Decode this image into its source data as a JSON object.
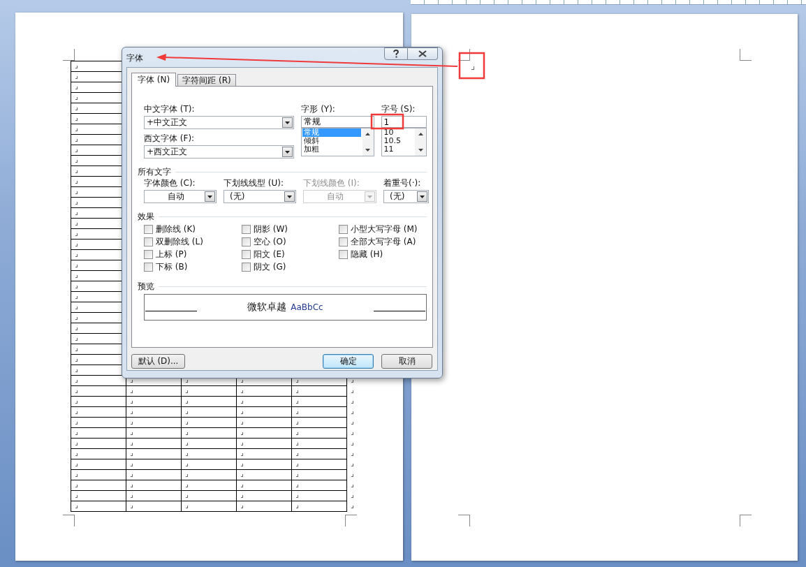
{
  "dialog": {
    "title": "字体",
    "tabs": [
      {
        "label": "字体 (N)",
        "selected": true
      },
      {
        "label": "字符间距 (R)",
        "selected": false
      }
    ],
    "chinese_font": {
      "label": "中文字体 (T):",
      "value": "+中文正文"
    },
    "western_font": {
      "label": "西文字体 (F):",
      "value": "+西文正文"
    },
    "font_style": {
      "label": "字形 (Y):",
      "value": "常规",
      "options": [
        {
          "label": "常规",
          "selected": true
        },
        {
          "label": "倾斜",
          "selected": false
        },
        {
          "label": "加粗",
          "selected": false
        }
      ]
    },
    "font_size": {
      "label": "字号 (S):",
      "value": "1",
      "options": [
        {
          "label": "10",
          "selected": false
        },
        {
          "label": "10.5",
          "selected": false
        },
        {
          "label": "11",
          "selected": false
        }
      ]
    },
    "all_text": {
      "heading": "所有文字",
      "fields": [
        {
          "label": "字体颜色 (C):",
          "value": "自动",
          "kind": "color",
          "disabled": false
        },
        {
          "label": "下划线线型 (U):",
          "value": "(无)",
          "kind": "style",
          "disabled": false
        },
        {
          "label": "下划线颜色 (I):",
          "value": "自动",
          "kind": "color",
          "disabled": true
        },
        {
          "label": "着重号(·):",
          "value": "(无)",
          "kind": "style",
          "disabled": false
        }
      ]
    },
    "effects": {
      "heading": "效果",
      "options": [
        {
          "label": "删除线 (K)",
          "checked": false
        },
        {
          "label": "双删除线 (L)",
          "checked": false
        },
        {
          "label": "上标 (P)",
          "checked": false
        },
        {
          "label": "下标 (B)",
          "checked": false
        },
        {
          "label": "阴影 (W)",
          "checked": false
        },
        {
          "label": "空心 (O)",
          "checked": false
        },
        {
          "label": "阳文 (E)",
          "checked": false
        },
        {
          "label": "阴文 (G)",
          "checked": false
        },
        {
          "label": "小型大写字母 (M)",
          "checked": false
        },
        {
          "label": "全部大写字母 (A)",
          "checked": false
        },
        {
          "label": "隐藏 (H)",
          "checked": false
        }
      ]
    },
    "preview": {
      "heading": "预览",
      "sample_cjk": "微软卓越",
      "sample_latin": "AaBbCc"
    },
    "buttons": [
      {
        "label": "默认 (D)...",
        "default": false
      },
      {
        "label": "确定",
        "default": true
      },
      {
        "label": "取消",
        "default": false
      }
    ]
  },
  "annotations": [
    {
      "kind": "arrow"
    },
    {
      "kind": "box"
    },
    {
      "kind": "box"
    }
  ]
}
